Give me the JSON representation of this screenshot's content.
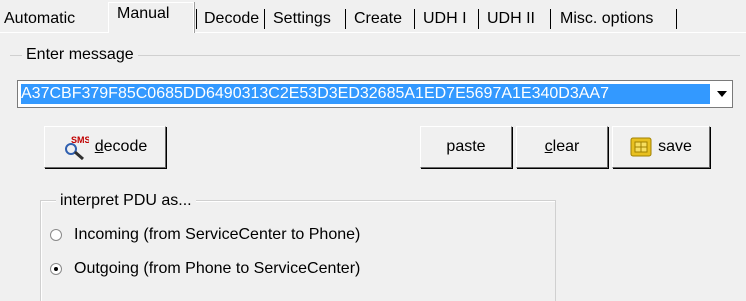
{
  "tabs": [
    {
      "label": "Automatic",
      "selected": false
    },
    {
      "label": "Manual",
      "selected": true
    },
    {
      "label": "Decode",
      "selected": false
    },
    {
      "label": "Settings",
      "selected": false
    },
    {
      "label": "Create",
      "selected": false
    },
    {
      "label": "UDH I",
      "selected": false
    },
    {
      "label": "UDH II",
      "selected": false
    },
    {
      "label": "Misc. options",
      "selected": false
    }
  ],
  "message": {
    "group_label": "Enter message",
    "value": "A37CBF379F85C0685DD6490313C2E53D3ED32685A1ED7E5697A1E340D3AA7"
  },
  "buttons": {
    "decode_accel": "d",
    "decode_rest": "ecode",
    "paste_label": "paste",
    "clear_accel": "c",
    "clear_rest": "lear",
    "save_label": "save"
  },
  "icons": {
    "decode": "sms-decode-icon",
    "save": "sim-card-icon"
  },
  "interpret": {
    "group_label": "interpret PDU as...",
    "options": [
      {
        "label": "Incoming (from ServiceCenter to Phone)",
        "selected": false
      },
      {
        "label": "Outgoing (from Phone to ServiceCenter)",
        "selected": true
      }
    ]
  },
  "colors": {
    "selection": "#3399ff",
    "window": "#f0f0f0"
  }
}
